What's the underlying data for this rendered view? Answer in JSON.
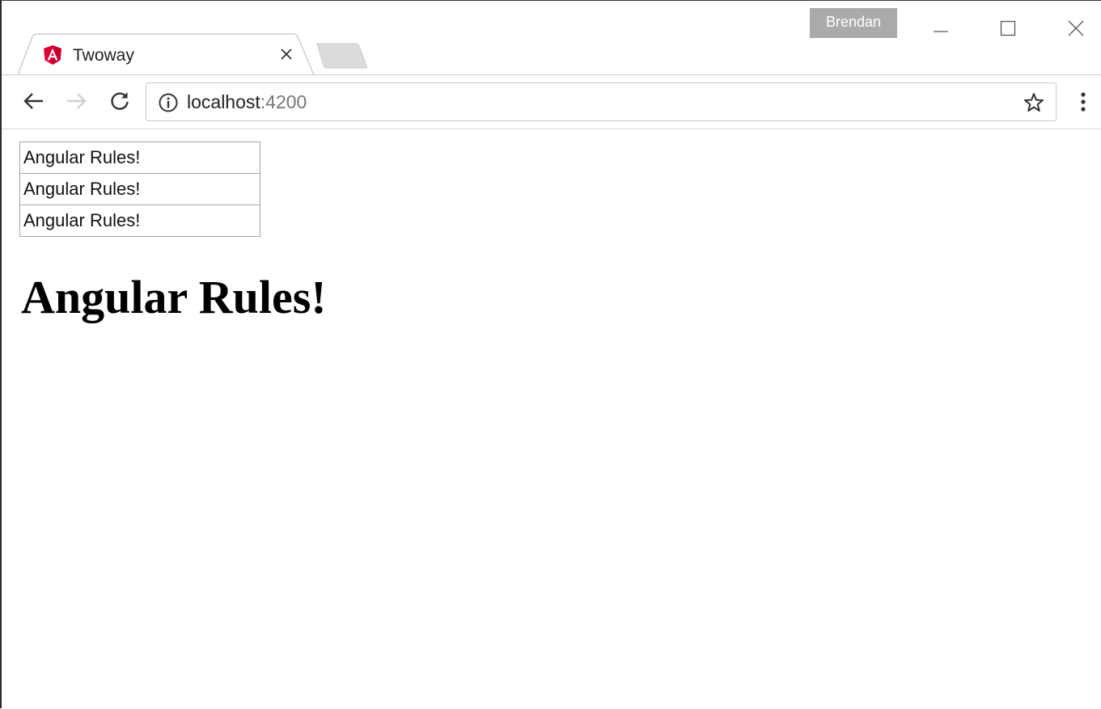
{
  "browser": {
    "tab": {
      "title": "Twoway",
      "favicon": "angular-logo-icon",
      "favicon_color": "#dd0031"
    },
    "profile_name": "Brendan",
    "window_controls": [
      "minimize-icon",
      "maximize-icon",
      "close-icon"
    ],
    "address_bar": {
      "host": "localhost",
      "port": ":4200",
      "security_icon": "info-icon"
    },
    "toolbar_icons": [
      "back-arrow-icon",
      "forward-arrow-icon",
      "reload-icon",
      "bookmark-star-icon",
      "menu-dots-icon"
    ]
  },
  "page": {
    "inputs": [
      {
        "value": "Angular Rules!"
      },
      {
        "value": "Angular Rules!"
      },
      {
        "value": "Angular Rules!"
      }
    ],
    "heading": "Angular Rules!"
  }
}
